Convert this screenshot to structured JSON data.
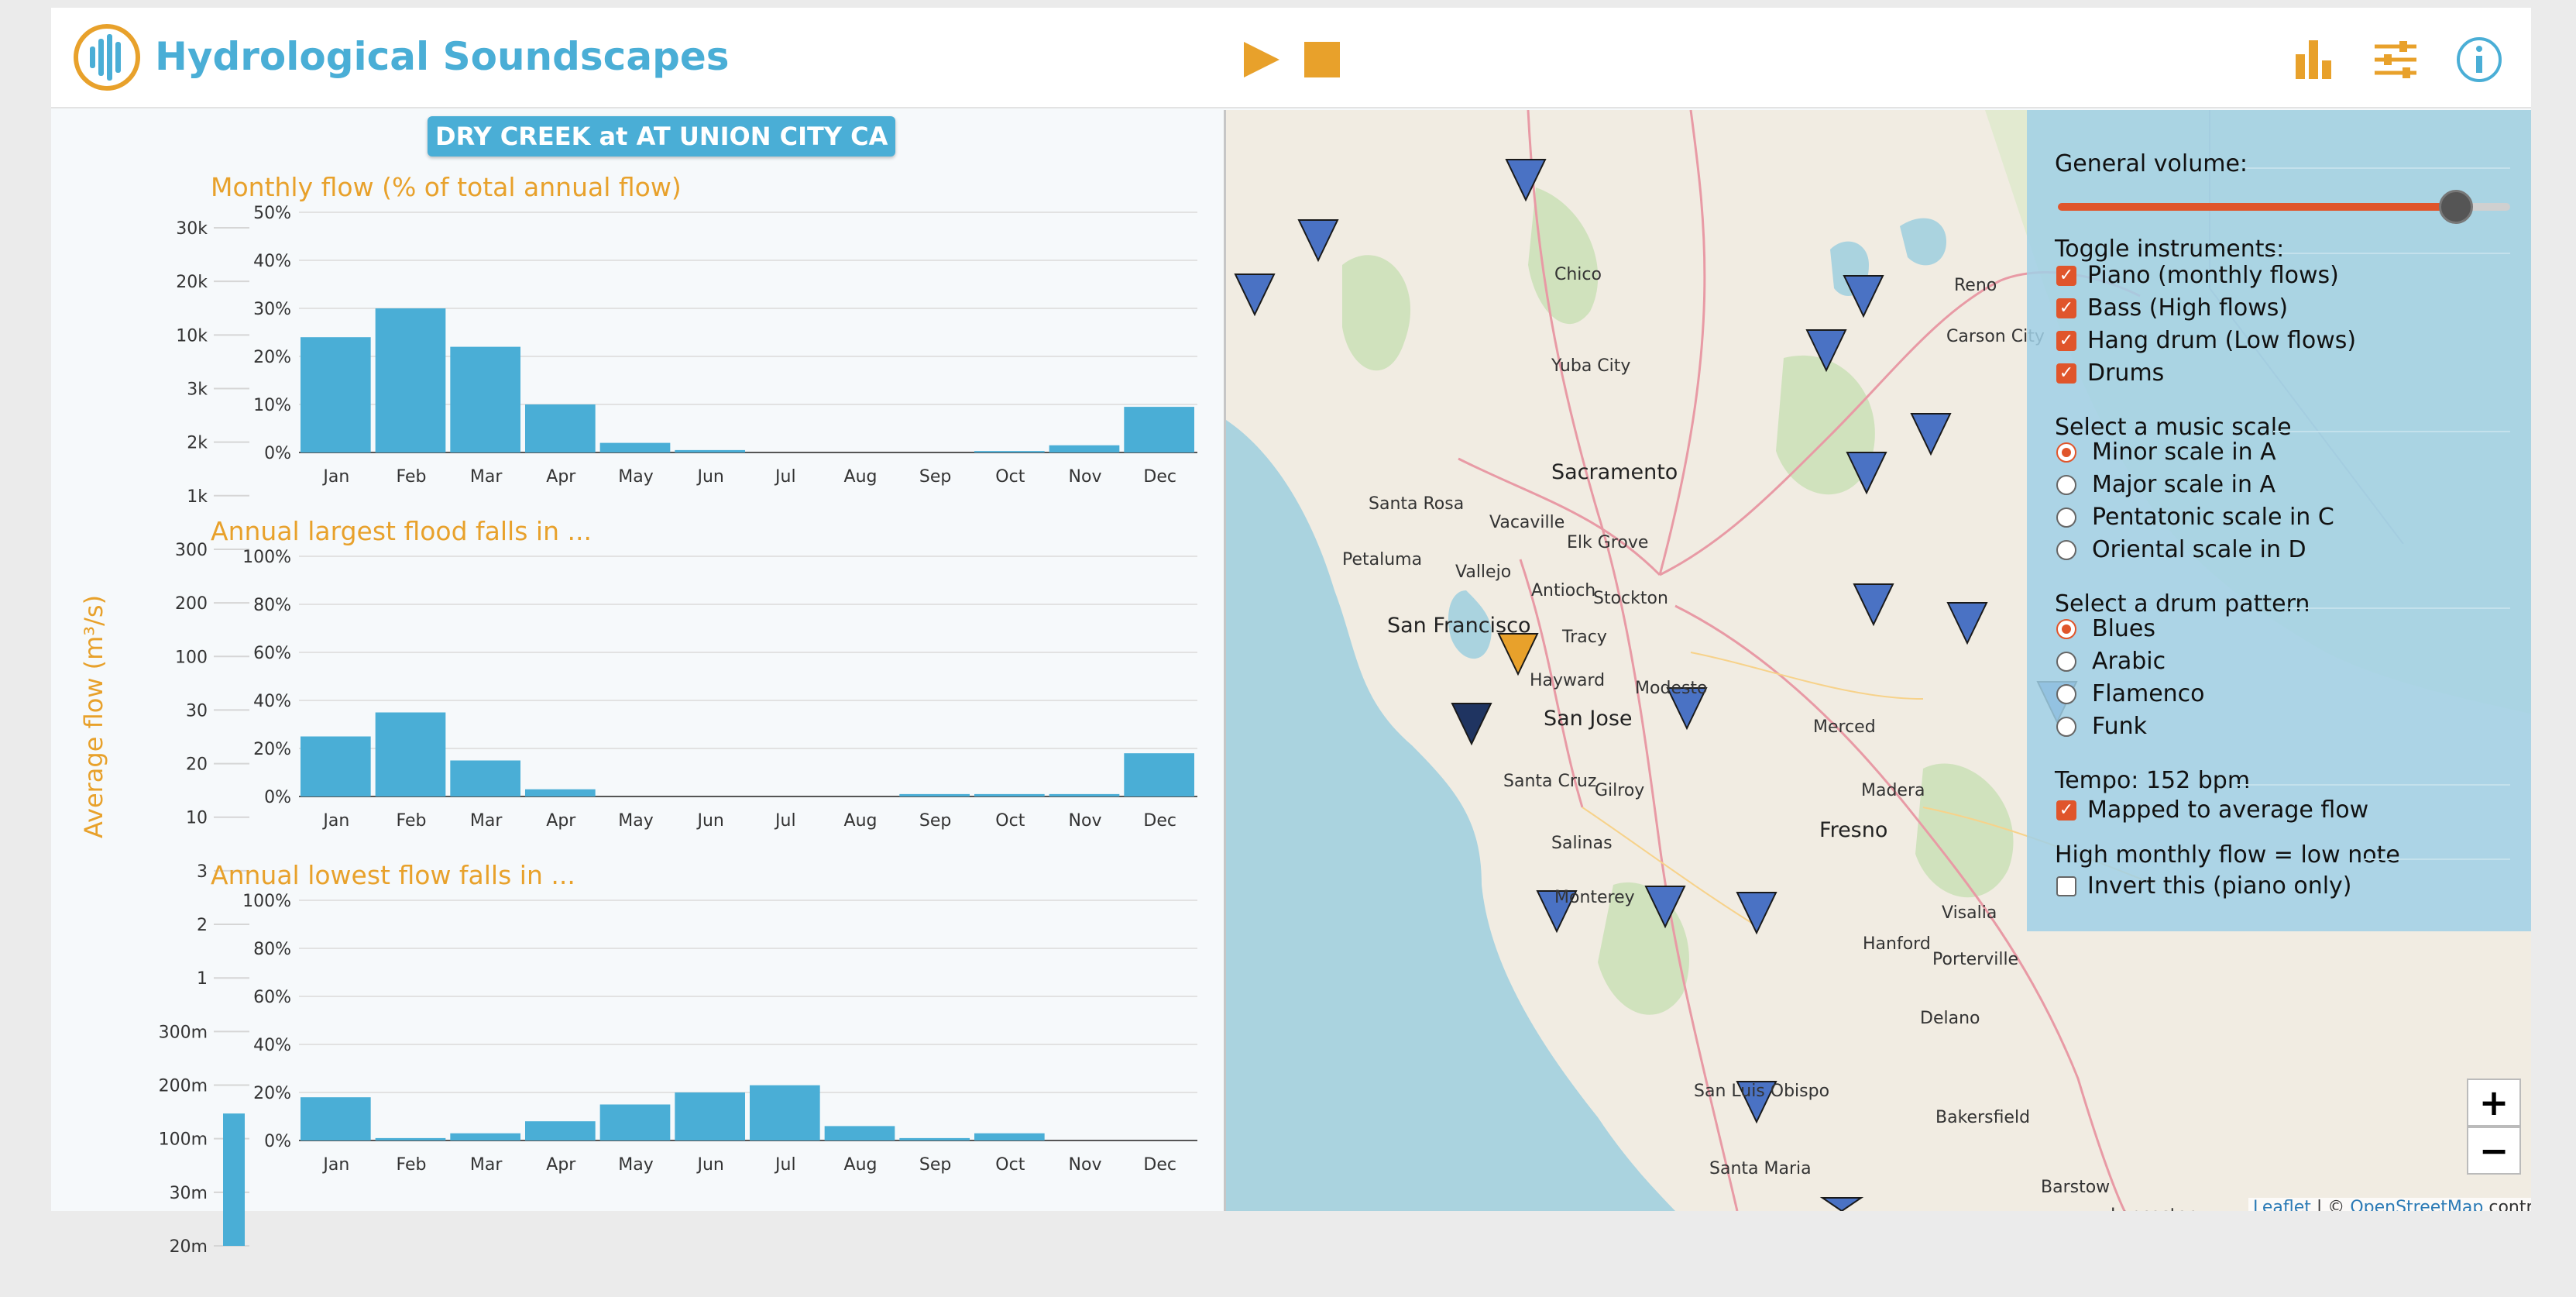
{
  "header": {
    "title": "Hydrological Soundscapes"
  },
  "colors": {
    "accent": "#4aaed6",
    "orange": "#e8a12b",
    "control": "#e0552b",
    "marker": "#4a72c4",
    "marker_dark": "#1f3461"
  },
  "icons": {
    "logo": "waveform-icon",
    "play": "play-icon",
    "stop": "stop-icon",
    "chart": "bar-chart-icon",
    "settings": "sliders-icon",
    "info": "info-icon"
  },
  "station": {
    "name": "DRY CREEK at AT UNION CITY CA"
  },
  "flow_axis": {
    "label": "Average flow (m³/s)",
    "ticks": [
      "30k",
      "20k",
      "10k",
      "3k",
      "2k",
      "1k",
      "300",
      "200",
      "100",
      "30",
      "20",
      "10",
      "3",
      "2",
      "1",
      "300m",
      "200m",
      "100m",
      "30m",
      "20m"
    ],
    "level_fraction": 0.13
  },
  "chart_data": [
    {
      "type": "bar",
      "title": "Monthly flow (% of total annual flow)",
      "categories": [
        "Jan",
        "Feb",
        "Mar",
        "Apr",
        "May",
        "Jun",
        "Jul",
        "Aug",
        "Sep",
        "Oct",
        "Nov",
        "Dec"
      ],
      "values": [
        24,
        30,
        22,
        10,
        2,
        0.5,
        0,
        0,
        0,
        0.3,
        1.5,
        9.5
      ],
      "ylim": [
        0,
        50
      ],
      "yticks": [
        "0%",
        "10%",
        "20%",
        "30%",
        "40%",
        "50%"
      ],
      "grid": true
    },
    {
      "type": "bar",
      "title": "Annual largest flood falls in ...",
      "categories": [
        "Jan",
        "Feb",
        "Mar",
        "Apr",
        "May",
        "Jun",
        "Jul",
        "Aug",
        "Sep",
        "Oct",
        "Nov",
        "Dec"
      ],
      "values": [
        25,
        35,
        15,
        3,
        0,
        0,
        0,
        0,
        1,
        1,
        1,
        18
      ],
      "ylim": [
        0,
        100
      ],
      "yticks": [
        "0%",
        "20%",
        "40%",
        "60%",
        "80%",
        "100%"
      ],
      "grid": true
    },
    {
      "type": "bar",
      "title": "Annual lowest flow falls in ...",
      "categories": [
        "Jan",
        "Feb",
        "Mar",
        "Apr",
        "May",
        "Jun",
        "Jul",
        "Aug",
        "Sep",
        "Oct",
        "Nov",
        "Dec"
      ],
      "values": [
        18,
        1,
        3,
        8,
        15,
        20,
        23,
        6,
        1,
        3,
        0,
        0
      ],
      "ylim": [
        0,
        100
      ],
      "yticks": [
        "0%",
        "20%",
        "40%",
        "60%",
        "80%",
        "100%"
      ],
      "grid": true
    }
  ],
  "map": {
    "places": [
      {
        "name": "Chico",
        "big": false
      },
      {
        "name": "Yuba City",
        "big": false
      },
      {
        "name": "Reno",
        "big": false
      },
      {
        "name": "Carson City",
        "big": false
      },
      {
        "name": "Sacramento",
        "big": true
      },
      {
        "name": "Santa Rosa",
        "big": false
      },
      {
        "name": "Vacaville",
        "big": false
      },
      {
        "name": "Elk Grove",
        "big": false
      },
      {
        "name": "Petaluma",
        "big": false
      },
      {
        "name": "Vallejo",
        "big": false
      },
      {
        "name": "Antioch",
        "big": false
      },
      {
        "name": "Stockton",
        "big": false
      },
      {
        "name": "San Francisco",
        "big": true
      },
      {
        "name": "Tracy",
        "big": false
      },
      {
        "name": "Hayward",
        "big": false
      },
      {
        "name": "Modesto",
        "big": false
      },
      {
        "name": "San Jose",
        "big": true
      },
      {
        "name": "Merced",
        "big": false
      },
      {
        "name": "Santa Cruz",
        "big": false
      },
      {
        "name": "Gilroy",
        "big": false
      },
      {
        "name": "Madera",
        "big": false
      },
      {
        "name": "Fresno",
        "big": true
      },
      {
        "name": "Salinas",
        "big": false
      },
      {
        "name": "Monterey",
        "big": false
      },
      {
        "name": "Visalia",
        "big": false
      },
      {
        "name": "Hanford",
        "big": false
      },
      {
        "name": "Porterville",
        "big": false
      },
      {
        "name": "Delano",
        "big": false
      },
      {
        "name": "Bakersfield",
        "big": false
      },
      {
        "name": "San Luis Obispo",
        "big": false
      },
      {
        "name": "Santa Maria",
        "big": false
      },
      {
        "name": "Barstow",
        "big": false
      },
      {
        "name": "Lancaster",
        "big": false
      }
    ],
    "zoom_in": "+",
    "zoom_out": "−",
    "attribution": {
      "leaflet": "Leaflet",
      "sep": " | © ",
      "osm": "OpenStreetMap",
      "tail": " contributors"
    }
  },
  "controls": {
    "volume_label": "General volume:",
    "volume_fraction": 0.88,
    "instruments_label": "Toggle instruments:",
    "instruments": [
      {
        "label": "Piano (monthly flows)",
        "checked": true
      },
      {
        "label": "Bass (High flows)",
        "checked": true
      },
      {
        "label": "Hang drum (Low flows)",
        "checked": true
      },
      {
        "label": "Drums",
        "checked": true
      }
    ],
    "scale_label": "Select a music scale",
    "scales": [
      {
        "label": "Minor scale in A",
        "selected": true
      },
      {
        "label": "Major scale in A",
        "selected": false
      },
      {
        "label": "Pentatonic scale in C",
        "selected": false
      },
      {
        "label": "Oriental scale in D",
        "selected": false
      }
    ],
    "drum_label": "Select a drum pattern",
    "drums": [
      {
        "label": "Blues",
        "selected": true
      },
      {
        "label": "Arabic",
        "selected": false
      },
      {
        "label": "Flamenco",
        "selected": false
      },
      {
        "label": "Funk",
        "selected": false
      }
    ],
    "tempo_label": "Tempo: 152 bpm",
    "tempo_option": {
      "label": "Mapped to average flow",
      "checked": true
    },
    "invert_label": "High monthly flow = low note",
    "invert_option": {
      "label": "Invert this (piano only)",
      "checked": false
    }
  }
}
